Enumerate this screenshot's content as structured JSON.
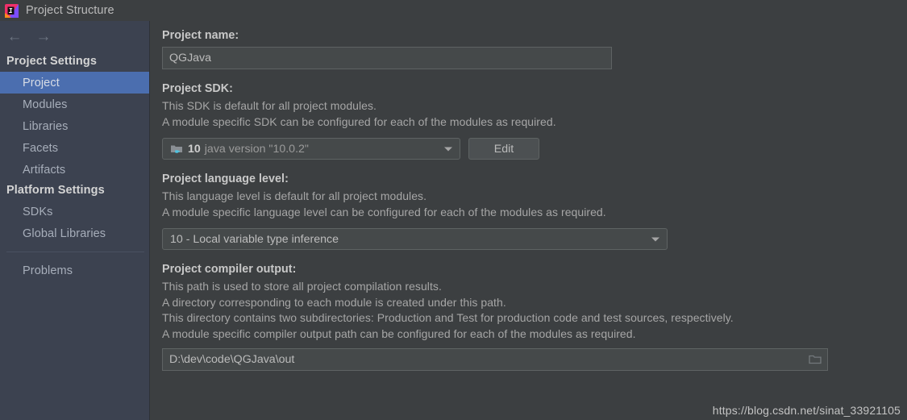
{
  "window": {
    "title": "Project Structure",
    "icon": "intellij-idea-logo-icon"
  },
  "sidebar": {
    "back_arrow": "←",
    "forward_arrow": "→",
    "groups": [
      {
        "header": "Project Settings",
        "items": [
          {
            "label": "Project",
            "selected": true
          },
          {
            "label": "Modules",
            "selected": false
          },
          {
            "label": "Libraries",
            "selected": false
          },
          {
            "label": "Facets",
            "selected": false
          },
          {
            "label": "Artifacts",
            "selected": false
          }
        ]
      },
      {
        "header": "Platform Settings",
        "items": [
          {
            "label": "SDKs",
            "selected": false
          },
          {
            "label": "Global Libraries",
            "selected": false
          }
        ]
      }
    ],
    "footer_items": [
      {
        "label": "Problems",
        "selected": false
      }
    ],
    "selection_color": "#4b6eaf",
    "background_color": "#3c4250"
  },
  "main": {
    "project_name": {
      "label": "Project name:",
      "value": "QGJava"
    },
    "project_sdk": {
      "label": "Project SDK:",
      "description_lines": [
        "This SDK is default for all project modules.",
        "A module specific SDK can be configured for each of the modules as required."
      ],
      "selected_version": "10",
      "selected_description": "java version \"10.0.2\"",
      "icon": "java-sdk-folder-icon",
      "edit_button": "Edit"
    },
    "language_level": {
      "label": "Project language level:",
      "description_lines": [
        "This language level is default for all project modules.",
        "A module specific language level can be configured for each of the modules as required."
      ],
      "selected": "10 - Local variable type inference"
    },
    "compiler_output": {
      "label": "Project compiler output:",
      "description_lines": [
        "This path is used to store all project compilation results.",
        "A directory corresponding to each module is created under this path.",
        "This directory contains two subdirectories: Production and Test for production code and test sources, respectively.",
        "A module specific compiler output path can be configured for each of the modules as required."
      ],
      "value": "D:\\dev\\code\\QGJava\\out",
      "browse_icon": "folder-browse-icon"
    }
  },
  "watermark": {
    "text": "https://blog.csdn.net/sinat_33921105"
  }
}
